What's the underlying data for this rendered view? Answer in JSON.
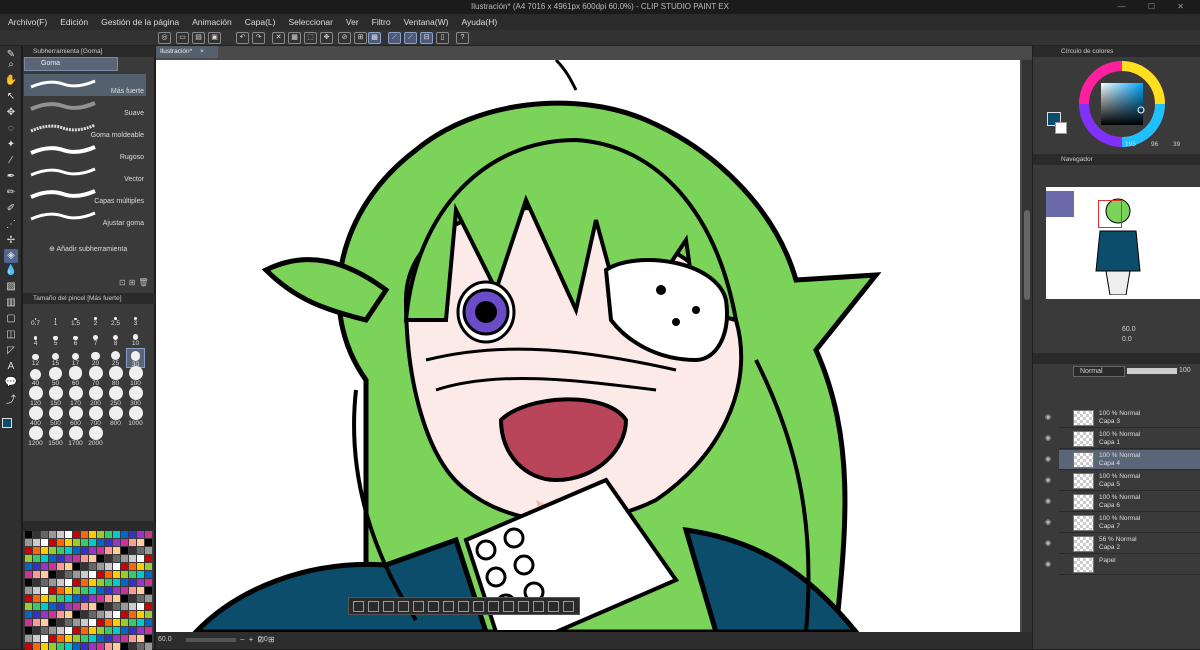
{
  "window": {
    "title": "Ilustración* (A4 7016 x 4961px 600dpi 60.0%) - CLIP STUDIO PAINT EX",
    "controls": "—  ☐  ✕"
  },
  "menu": [
    "Archivo(F)",
    "Edición",
    "Gestión de la página",
    "Animación",
    "Capa(L)",
    "Seleccionar",
    "Ver",
    "Filtro",
    "Ventana(W)",
    "Ayuda(H)"
  ],
  "subtool_panel": {
    "title": "Subherramienta [Goma]",
    "tab": "Goma",
    "items": [
      {
        "label": "Más fuerte",
        "selected": true
      },
      {
        "label": "Suave"
      },
      {
        "label": "Goma moldeable"
      },
      {
        "label": "Rugoso"
      },
      {
        "label": "Vector"
      },
      {
        "label": "Capas múltiples"
      },
      {
        "label": "Ajustar goma"
      }
    ],
    "add_label": "Añadir subherramienta"
  },
  "brush_size": {
    "title": "Tamaño del pincel [Más fuerte]",
    "sizes": [
      "0.7",
      "1",
      "1.5",
      "2",
      "2.5",
      "3",
      "4",
      "5",
      "6",
      "7",
      "8",
      "10",
      "12",
      "15",
      "17",
      "20",
      "25",
      "30",
      "40",
      "50",
      "60",
      "70",
      "80",
      "100",
      "120",
      "150",
      "170",
      "200",
      "250",
      "300",
      "400",
      "500",
      "600",
      "700",
      "800",
      "1000",
      "1200",
      "1500",
      "1700",
      "2000"
    ],
    "selected": "30"
  },
  "colors": {
    "main": "#0b4d6b",
    "sub": "#ffffff",
    "accent": "#5a6678",
    "hair": "#7cd35a"
  },
  "canvas": {
    "tab": "Ilustración*",
    "zoom": "60.0",
    "rotation": "0.0"
  },
  "color_wheel": {
    "title": "Círculo de colores",
    "h": "195",
    "s": "96",
    "v": "39"
  },
  "navigator": {
    "title": "Navegador",
    "zoom": "60.0",
    "angle": "0.0"
  },
  "layers": {
    "blend": "Normal",
    "opacity": "100",
    "items": [
      {
        "line1": "100 % Normal",
        "line2": "Capa 3"
      },
      {
        "line1": "100 % Normal",
        "line2": "Capa 1"
      },
      {
        "line1": "100 % Normal",
        "line2": "Capa 4",
        "selected": true
      },
      {
        "line1": "100 % Normal",
        "line2": "Capa 5"
      },
      {
        "line1": "100 % Normal",
        "line2": "Capa 6"
      },
      {
        "line1": "100 % Normal",
        "line2": "Capa 7"
      },
      {
        "line1": "56 % Normal",
        "line2": "Capa 2"
      },
      {
        "line1": "",
        "line2": "Papel"
      }
    ]
  }
}
